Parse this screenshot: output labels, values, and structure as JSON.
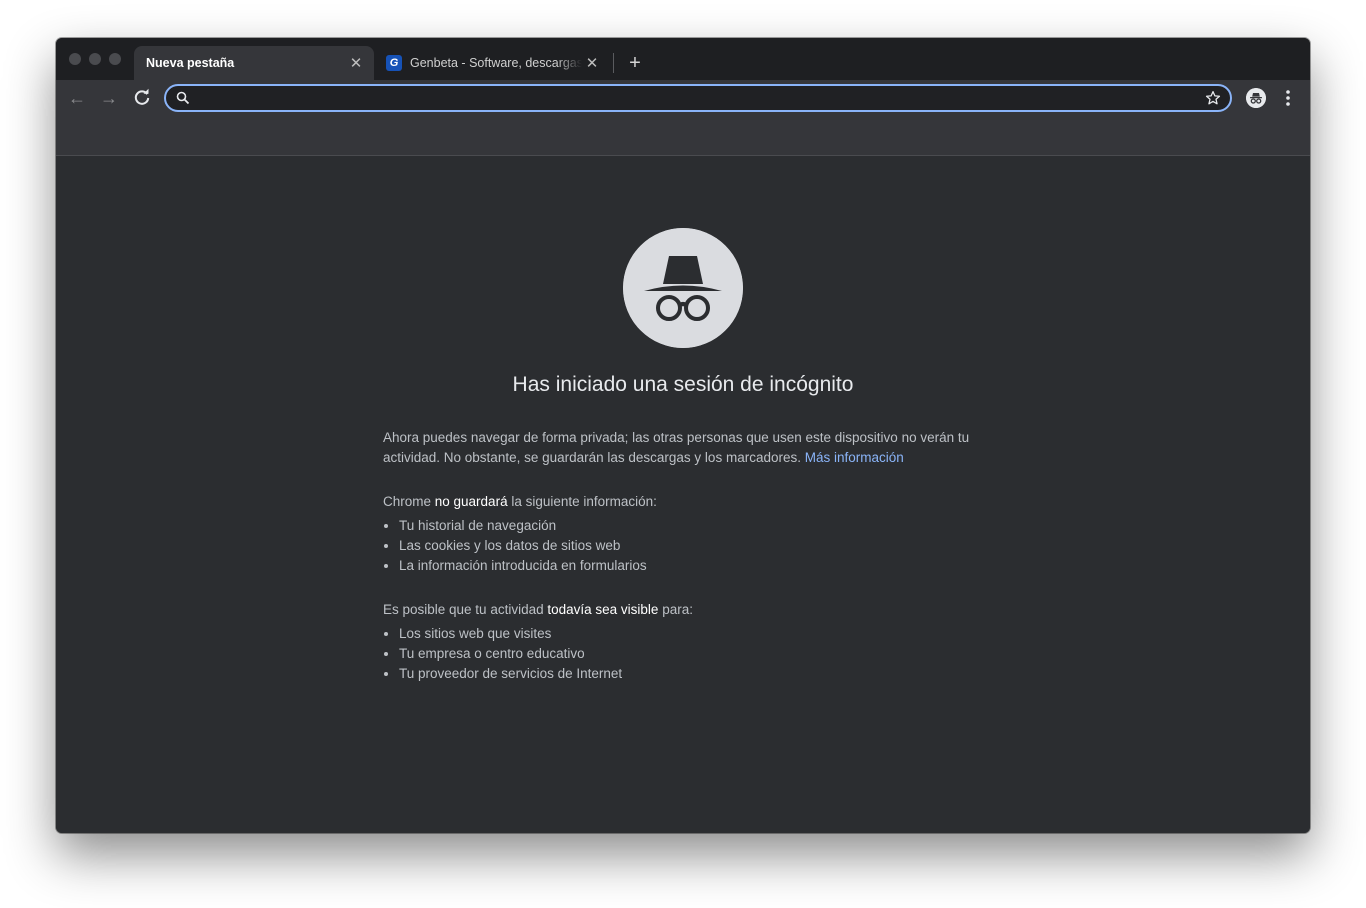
{
  "tabs": [
    {
      "title": "Nueva pestaña",
      "active": true
    },
    {
      "title": "Genbeta - Software, descargas",
      "active": false,
      "favicon_letter": "G"
    }
  ],
  "new_tab_symbol": "+",
  "close_symbol": "✕",
  "omnibox": {
    "value": "",
    "placeholder": ""
  },
  "nav": {
    "back": "←",
    "forward": "→"
  },
  "page": {
    "heading": "Has iniciado una sesión de incógnito",
    "intro": "Ahora puedes navegar de forma privada; las otras personas que usen este dispositivo no verán tu actividad. No obstante, se guardarán las descargas y los marcadores. ",
    "learn_more": "Más información",
    "not_saved_prefix": "Chrome ",
    "not_saved_strong": "no guardará",
    "not_saved_suffix": " la siguiente información:",
    "not_saved_items": [
      "Tu historial de navegación",
      "Las cookies y los datos de sitios web",
      "La información introducida en formularios"
    ],
    "visible_prefix": "Es posible que tu actividad ",
    "visible_strong": "todavía sea visible",
    "visible_suffix": " para:",
    "visible_items": [
      "Los sitios web que visites",
      "Tu empresa o centro educativo",
      "Tu proveedor de servicios de Internet"
    ]
  },
  "colors": {
    "accent": "#8ab4f8",
    "background": "#2b2d30",
    "tabstrip": "#1e1f22",
    "toolbar": "#35363a"
  }
}
